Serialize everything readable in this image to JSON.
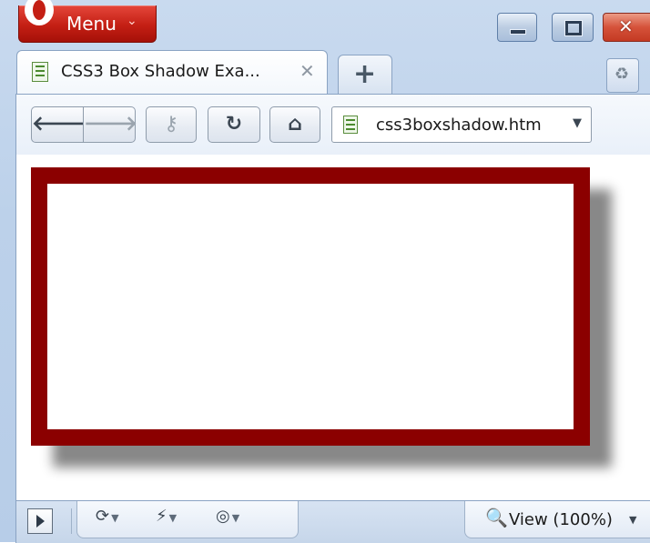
{
  "titlebar": {
    "menu_label": "Menu",
    "menu_caret": "⌄"
  },
  "window_controls": {
    "minimize": "minimize-icon",
    "maximize": "maximize-icon",
    "close": "close-icon"
  },
  "tabs": [
    {
      "label": "CSS3 Box Shadow Exa...",
      "close_glyph": "✕",
      "active": true
    }
  ],
  "new_tab_glyph": "+",
  "trash_glyph": "♻",
  "toolbar": {
    "back_glyph": "🡐",
    "forward_glyph": "🡒",
    "key_glyph": "⚷",
    "reload_glyph": "↻",
    "home_glyph": "⌂",
    "address": "css3boxshadow.htm",
    "address_dropdown": "▼"
  },
  "page": {
    "box_border_color": "#8b0000",
    "box_background": "#ffffff",
    "shadow_color": "#888888"
  },
  "statusbar": {
    "sync_glyph": "⟳",
    "unite_glyph": "⚡",
    "turbo_glyph": "◎",
    "caret": "▼",
    "zoom_glyph": "🔍",
    "view_label": "View (100%)",
    "view_caret": "▼"
  }
}
